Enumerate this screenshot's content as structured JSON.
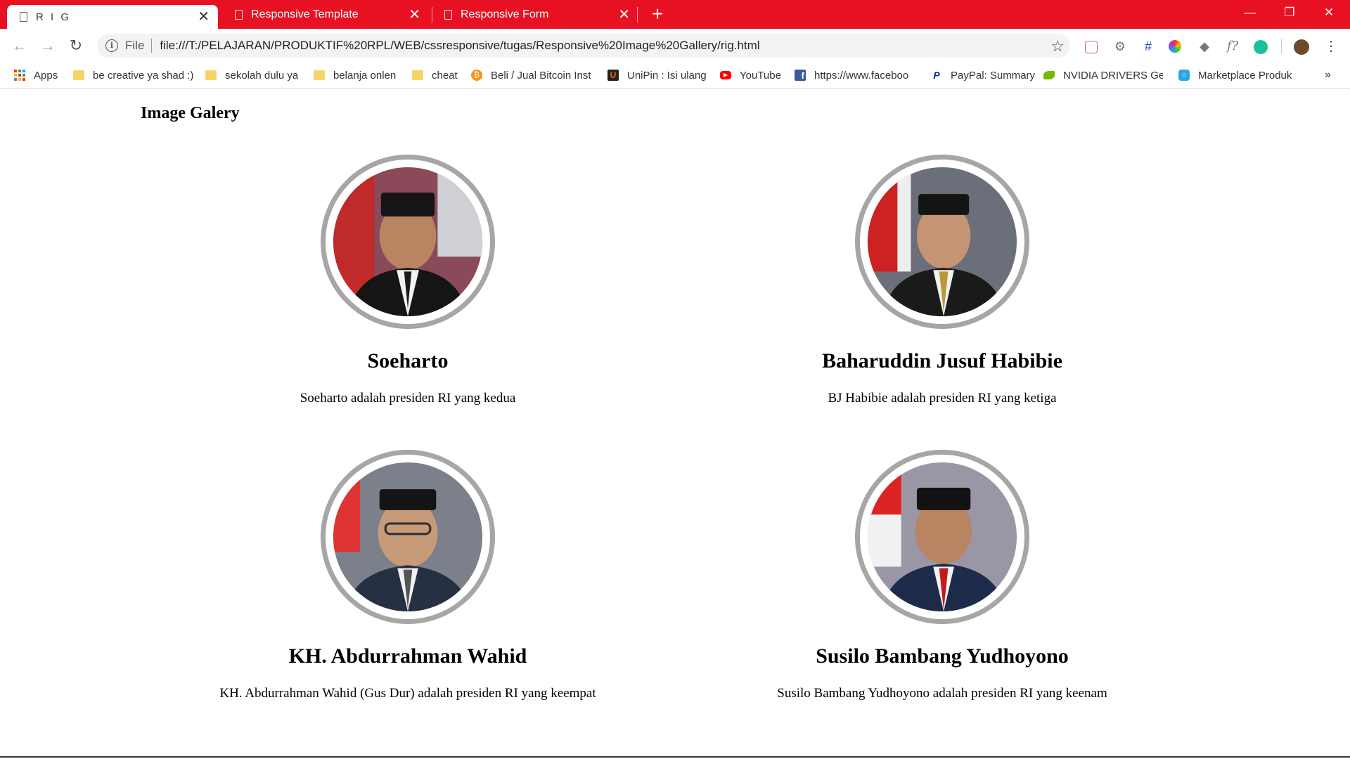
{
  "browser": {
    "tabs": [
      {
        "label": "R I G"
      },
      {
        "label": "Responsive Template"
      },
      {
        "label": "Responsive Form"
      }
    ],
    "scheme": "File",
    "url": "file:///T:/PELAJARAN/PRODUKTIF%20RPL/WEB/cssresponsive/tugas/Responsive%20Image%20Gallery/rig.html",
    "accent_color": "#e81123",
    "bookmarks": [
      {
        "label": "Apps",
        "icon": "apps-grid-icon"
      },
      {
        "label": "be creative ya shad :)",
        "icon": "folder-icon"
      },
      {
        "label": "sekolah dulu ya",
        "icon": "folder-icon"
      },
      {
        "label": "belanja onlen",
        "icon": "folder-icon"
      },
      {
        "label": "cheat",
        "icon": "folder-icon"
      },
      {
        "label": "Beli / Jual Bitcoin Inst",
        "icon": "bitcoin-icon"
      },
      {
        "label": "UniPin : Isi ulang",
        "icon": "unipin-icon"
      },
      {
        "label": "YouTube",
        "icon": "youtube-icon"
      },
      {
        "label": "https://www.faceboo",
        "icon": "facebook-icon"
      },
      {
        "label": "PayPal: Summary",
        "icon": "paypal-icon"
      },
      {
        "label": "NVIDIA DRIVERS GeF",
        "icon": "nvidia-icon"
      },
      {
        "label": "Marketplace Produk",
        "icon": "marketplace-icon"
      }
    ],
    "bookmarks_overflow": "»"
  },
  "page": {
    "title": "Image Galery",
    "cards": [
      {
        "name": "Soeharto",
        "desc": "Soeharto adalah presiden RI yang kedua"
      },
      {
        "name": "Baharuddin Jusuf Habibie",
        "desc": "BJ Habibie adalah presiden RI yang ketiga"
      },
      {
        "name": "KH. Abdurrahman Wahid",
        "desc": "KH. Abdurrahman Wahid (Gus Dur) adalah presiden RI yang keempat"
      },
      {
        "name": "Susilo Bambang Yudhoyono",
        "desc": "Susilo Bambang Yudhoyono adalah presiden RI yang keenam"
      }
    ]
  }
}
